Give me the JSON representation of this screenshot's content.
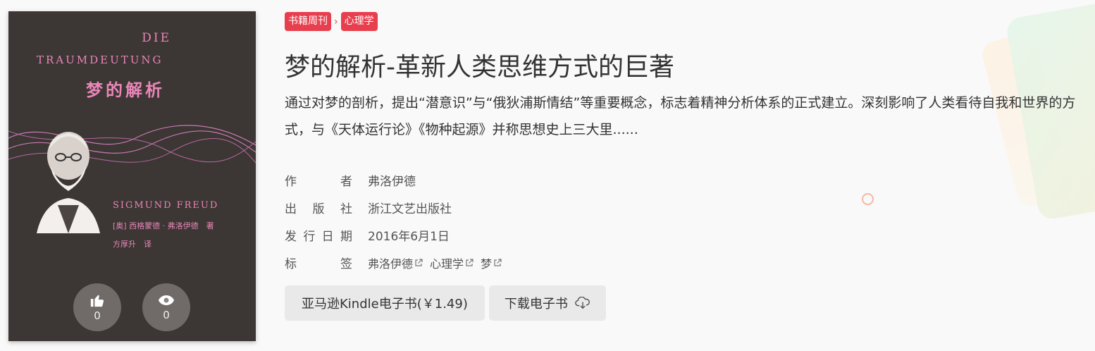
{
  "cover": {
    "title_de_line1": "DIE",
    "title_de_line2": "TRAUMDEUTUNG",
    "title_cn": "梦的解析",
    "author_en": "SIGMUND FREUD",
    "author_cn": "[奥] 西格蒙德 · 弗洛伊德　著",
    "translator": "方厚升　译",
    "like_count": "0",
    "view_count": "0"
  },
  "breadcrumb": {
    "category": "书籍周刊",
    "subcategory": "心理学"
  },
  "book": {
    "title": "梦的解析-革新人类思维方式的巨著",
    "description": "通过对梦的剖析，提出“潜意识”与“俄狄浦斯情结”等重要概念，标志着精神分析体系的正式建立。深刻影响了人类看待自我和世界的方式，与《天体运行论》《物种起源》并称思想史上三大里......",
    "author_label": [
      "作",
      "者"
    ],
    "author": "弗洛伊德",
    "publisher_label": [
      "出",
      "版",
      "社"
    ],
    "publisher": "浙江文艺出版社",
    "date_label": [
      "发",
      "行",
      "日",
      "期"
    ],
    "date": "2016年6月1日",
    "tags_label": [
      "标",
      "签"
    ],
    "tags": [
      "弗洛伊德",
      "心理学",
      "梦"
    ]
  },
  "actions": {
    "kindle": "亚马逊Kindle电子书(￥1.49)",
    "download": "下载电子书"
  },
  "colors": {
    "accent": "#e83f4e",
    "cover_bg": "#3c3634",
    "cover_text": "#e986b8"
  }
}
